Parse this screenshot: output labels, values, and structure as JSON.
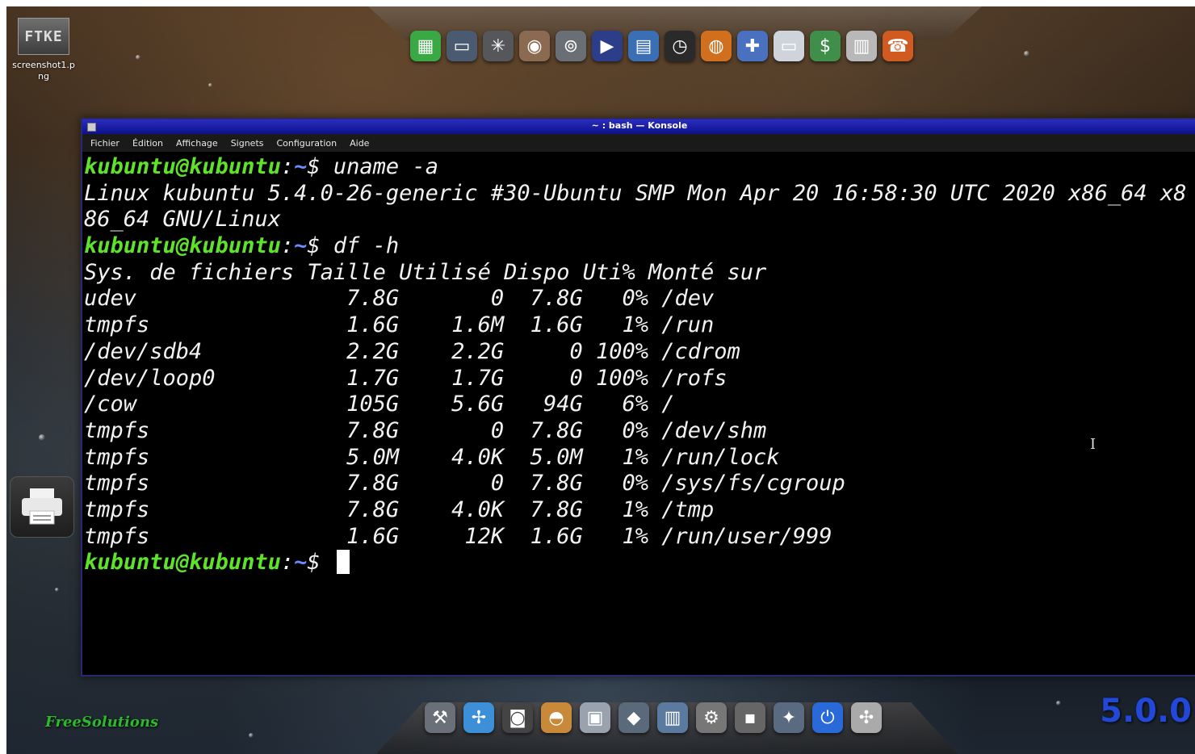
{
  "desktop": {
    "file_icon": {
      "label": "screenshot1.png",
      "thumb_text": "FTKE"
    },
    "brand": "FreeSolutions",
    "version": "5.0.0"
  },
  "top_dock": {
    "items": [
      {
        "icon": "spreadsheet-icon",
        "glyph": "▦",
        "color": "#3aa845"
      },
      {
        "icon": "archive-icon",
        "glyph": "▭",
        "color": "#4a5a70"
      },
      {
        "icon": "spider-web-icon",
        "glyph": "✳",
        "color": "#55575a"
      },
      {
        "icon": "social-media-icon",
        "glyph": "◉",
        "color": "#8a6a50"
      },
      {
        "icon": "tape-recorder-icon",
        "glyph": "⊚",
        "color": "#6a6f76"
      },
      {
        "icon": "youtube-icon",
        "glyph": "▶",
        "color": "#2c3e8a"
      },
      {
        "icon": "apps-grid-icon",
        "glyph": "▤",
        "color": "#3b6fb5"
      },
      {
        "icon": "clock-icon",
        "glyph": "◷",
        "color": "#2a2a2a"
      },
      {
        "icon": "globe-flame-icon",
        "glyph": "◍",
        "color": "#d0701f"
      },
      {
        "icon": "gamepad-icon",
        "glyph": "✚",
        "color": "#4a70c0"
      },
      {
        "icon": "drive-icon",
        "glyph": "▭",
        "color": "#cfd4dc"
      },
      {
        "icon": "money-icon",
        "glyph": "$",
        "color": "#3f8f4a"
      },
      {
        "icon": "news-icon",
        "glyph": "▥",
        "color": "#b8b8b8"
      },
      {
        "icon": "phone-icon",
        "glyph": "☎",
        "color": "#d05a20"
      }
    ]
  },
  "bottom_dock": {
    "items": [
      {
        "icon": "toolbox-icon",
        "glyph": "⚒",
        "color": "#6a6f78"
      },
      {
        "icon": "pinwheel-icon",
        "glyph": "✢",
        "color": "#3d8fd8"
      },
      {
        "icon": "camera-icon",
        "glyph": "◙",
        "color": "#444"
      },
      {
        "icon": "helmet-icon",
        "glyph": "◓",
        "color": "#c88a3a"
      },
      {
        "icon": "usb-drive-icon",
        "glyph": "▣",
        "color": "#9aa3ad"
      },
      {
        "icon": "turtle-icon",
        "glyph": "◆",
        "color": "#5a6a7a"
      },
      {
        "icon": "server-icon",
        "glyph": "▥",
        "color": "#5a7aa0"
      },
      {
        "icon": "settings-tools-icon",
        "glyph": "⚙",
        "color": "#777"
      },
      {
        "icon": "disk-icon",
        "glyph": "▪",
        "color": "#666"
      },
      {
        "icon": "wizard-icon",
        "glyph": "✦",
        "color": "#5a6a80"
      },
      {
        "icon": "power-icon",
        "glyph": "⏻",
        "color": "#2a6ad8"
      },
      {
        "icon": "puzzle-icon",
        "glyph": "✣",
        "color": "#aaa"
      }
    ]
  },
  "window": {
    "title": "~ : bash — Konsole",
    "menu": [
      "Fichier",
      "Édition",
      "Affichage",
      "Signets",
      "Configuration",
      "Aide"
    ]
  },
  "terminal": {
    "prompt_user": "kubuntu@kubuntu",
    "prompt_path": "~",
    "prompt_symbol": "$",
    "lines": [
      {
        "type": "prompt",
        "cmd": "uname -a"
      },
      {
        "type": "out",
        "text": "Linux kubuntu 5.4.0-26-generic #30-Ubuntu SMP Mon Apr 20 16:58:30 UTC 2020 x86_64 x8"
      },
      {
        "type": "out",
        "text": "86_64 GNU/Linux"
      },
      {
        "type": "prompt",
        "cmd": "df -h"
      },
      {
        "type": "out",
        "text": "Sys. de fichiers Taille Utilisé Dispo Uti% Monté sur"
      },
      {
        "type": "out",
        "text": "udev                7.8G       0  7.8G   0% /dev"
      },
      {
        "type": "out",
        "text": "tmpfs               1.6G    1.6M  1.6G   1% /run"
      },
      {
        "type": "out",
        "text": "/dev/sdb4           2.2G    2.2G     0 100% /cdrom"
      },
      {
        "type": "out",
        "text": "/dev/loop0          1.7G    1.7G     0 100% /rofs"
      },
      {
        "type": "out",
        "text": "/cow                105G    5.6G   94G   6% /"
      },
      {
        "type": "out",
        "text": "tmpfs               7.8G       0  7.8G   0% /dev/shm"
      },
      {
        "type": "out",
        "text": "tmpfs               5.0M    4.0K  5.0M   1% /run/lock"
      },
      {
        "type": "out",
        "text": "tmpfs               7.8G       0  7.8G   0% /sys/fs/cgroup"
      },
      {
        "type": "out",
        "text": "tmpfs               7.8G    4.0K  7.8G   1% /tmp"
      },
      {
        "type": "out",
        "text": "tmpfs               1.6G     12K  1.6G   1% /run/user/999"
      },
      {
        "type": "prompt",
        "cmd": "",
        "cursor": true
      }
    ]
  }
}
